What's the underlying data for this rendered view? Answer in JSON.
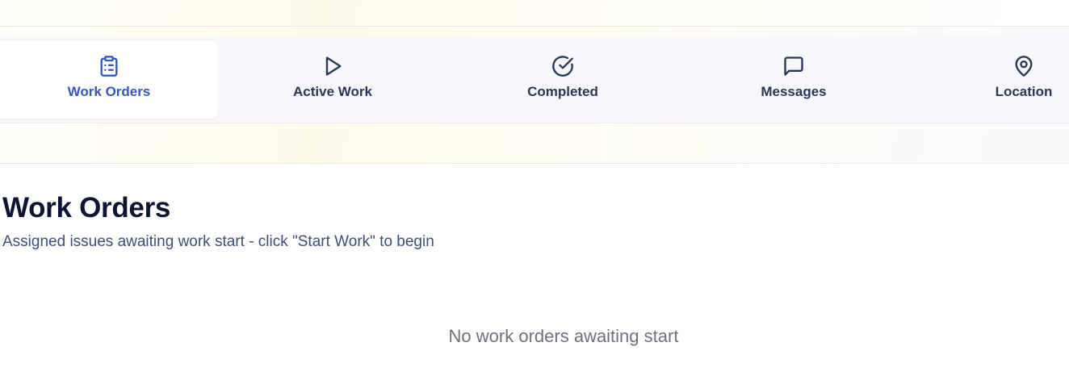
{
  "colors": {
    "accent": "#2f58c9",
    "tab_text": "#28365a",
    "title": "#0b1533",
    "subtitle": "#38507a",
    "muted": "#6b7280"
  },
  "tabs": [
    {
      "label": "Work Orders",
      "icon": "clipboard-list-icon",
      "active": true
    },
    {
      "label": "Active Work",
      "icon": "play-icon",
      "active": false
    },
    {
      "label": "Completed",
      "icon": "check-circle-icon",
      "active": false
    },
    {
      "label": "Messages",
      "icon": "message-square-icon",
      "active": false
    },
    {
      "label": "Location",
      "icon": "map-pin-icon",
      "active": false
    }
  ],
  "main": {
    "title": "Work Orders",
    "subtitle": "Assigned issues awaiting work start - click \"Start Work\" to begin",
    "empty_message": "No work orders awaiting start"
  }
}
